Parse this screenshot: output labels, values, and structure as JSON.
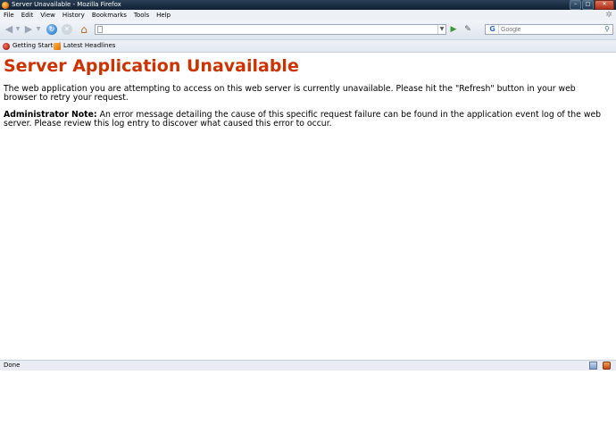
{
  "window": {
    "title": "Server Unavailable - Mozilla Firefox",
    "minimize": "–",
    "maximize": "□",
    "close": "✕"
  },
  "menu": {
    "items": [
      "File",
      "Edit",
      "View",
      "History",
      "Bookmarks",
      "Tools",
      "Help"
    ]
  },
  "navbar": {
    "back_icon": "◀",
    "forward_icon": "▶",
    "dropdown_icon": "▼",
    "reload_icon": "↻",
    "stop_icon": "✕",
    "home_icon": "⌂",
    "url_value": "",
    "go_icon": "▶",
    "tool_icon": "✎",
    "search_engine_icon": "G",
    "search_placeholder": "Google",
    "search_go_icon": "⚲"
  },
  "bookmarks": {
    "items": [
      "Getting Started",
      "Latest Headlines"
    ]
  },
  "content": {
    "heading": "Server Application Unavailable",
    "paragraph1": "The web application you are attempting to access on this web server is currently unavailable.  Please hit the \"Refresh\" button in your web browser to retry your request.",
    "note_label": "Administrator Note:",
    "note_text": " An error message detailing the cause of this specific request failure can be found in the application event log of the web server. Please review this log entry to discover what caused this error to occur."
  },
  "status": {
    "text": "Done"
  },
  "colors": {
    "heading": "#cc3300",
    "titlebar": "#0f2134"
  }
}
